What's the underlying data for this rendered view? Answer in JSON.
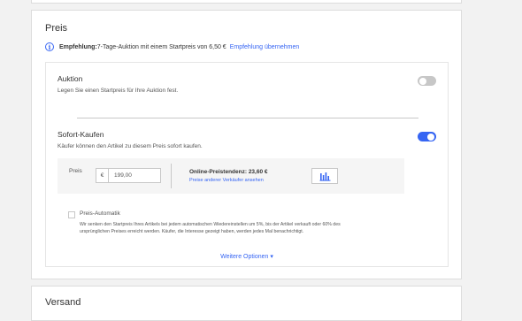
{
  "price_section": {
    "title": "Preis",
    "recommendation": {
      "icon": "info-icon",
      "label": "Empfehlung:",
      "text": " 7-Tage-Auktion mit einem Startpreis von 6,50 €",
      "link": "Empfehlung übernehmen"
    },
    "auction": {
      "title": "Auktion",
      "description": "Legen Sie einen Startpreis für Ihre Auktion fest.",
      "enabled": false
    },
    "buy_now": {
      "title": "Sofort-Kaufen",
      "description": "Käufer können den Artikel zu diesem Preis sofort kaufen.",
      "enabled": true,
      "price_label": "Preis",
      "currency": "€",
      "price_value": "199,00",
      "trend_title": "Online-Preistendenz: 23,60 €",
      "trend_link": "Preise anderer Verkäufer ansehen",
      "chart_button_icon": "bar-chart-icon"
    },
    "auto_price": {
      "label": "Preis-Automatik",
      "checked": false,
      "description_line1": "Wir senken den Startpreis Ihres Artikels bei jedem automatischen Wiedereinstellen um 5%, bis der Artikel verkauft oder 60% des",
      "description_line2": "ursprünglichen Preises erreicht werden. Käufer, die Interesse gezeigt haben, werden jedes Mal benachrichtigt."
    },
    "more_options": "Weitere Optionen ▾"
  },
  "shipping_section": {
    "title": "Versand"
  },
  "colors": {
    "accent": "#3665f3",
    "toggle_off": "#c7c7c7",
    "background": "#f2f2f2"
  }
}
